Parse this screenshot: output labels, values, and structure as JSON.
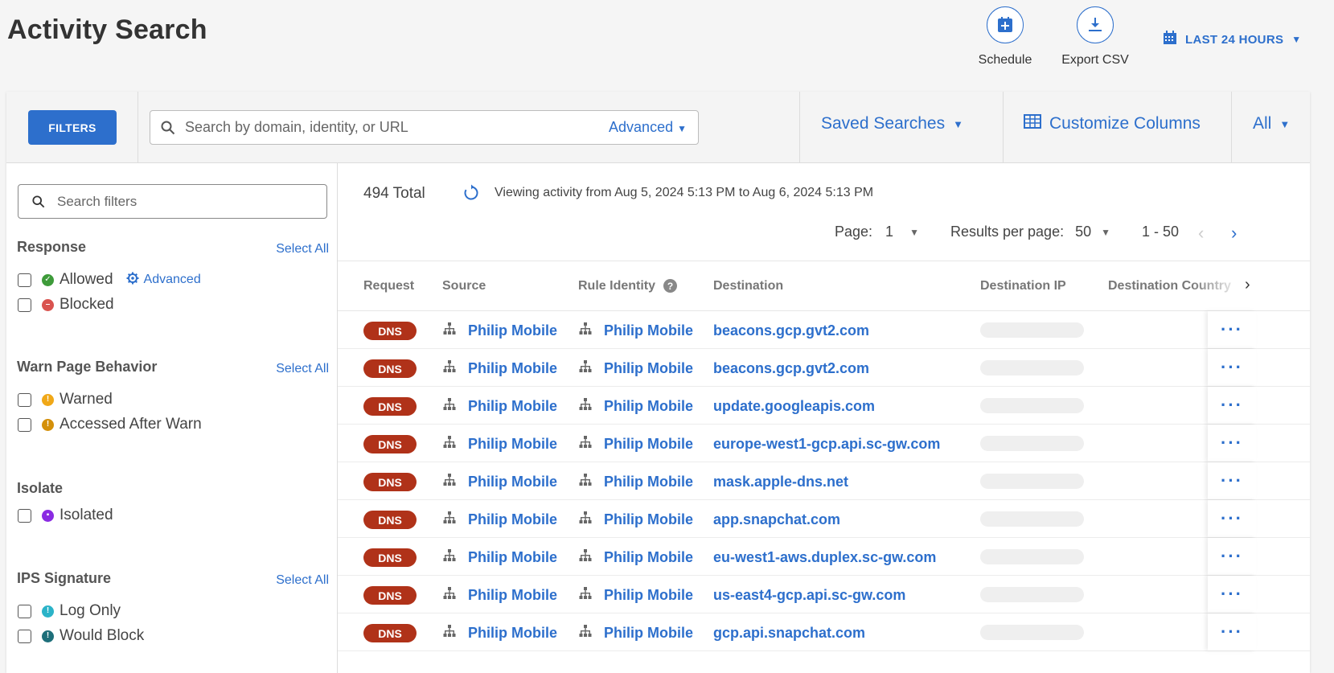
{
  "page": {
    "title": "Activity Search"
  },
  "header_actions": {
    "schedule_label": "Schedule",
    "export_label": "Export CSV",
    "time_range": "LAST 24 HOURS"
  },
  "toolbar": {
    "filters_label": "FILTERS",
    "search_placeholder": "Search by domain, identity, or URL",
    "advanced_label": "Advanced",
    "saved_searches_label": "Saved Searches",
    "customize_columns_label": "Customize Columns",
    "all_label": "All"
  },
  "sidebar": {
    "filter_search_placeholder": "Search filters",
    "select_all": "Select All",
    "sections": [
      {
        "title": "Response",
        "items": [
          {
            "label": "Allowed",
            "color": "#3e9b3a"
          },
          {
            "label": "Blocked",
            "color": "#d9534f"
          }
        ],
        "advanced_label": "Advanced"
      },
      {
        "title": "Warn Page Behavior",
        "items": [
          {
            "label": "Warned",
            "color": "#f0a818"
          },
          {
            "label": "Accessed After Warn",
            "color": "#d4900a"
          }
        ]
      },
      {
        "title": "Isolate",
        "items": [
          {
            "label": "Isolated",
            "color": "#8a2be2"
          }
        ]
      },
      {
        "title": "IPS Signature",
        "items": [
          {
            "label": "Log Only",
            "color": "#2bb3c8"
          },
          {
            "label": "Would Block",
            "color": "#1e6f7a"
          }
        ]
      }
    ]
  },
  "summary": {
    "total": "494 Total",
    "viewing": "Viewing activity from Aug 5, 2024 5:13 PM to Aug 6, 2024 5:13 PM",
    "page_label": "Page:",
    "page_value": "1",
    "rpp_label": "Results per page:",
    "rpp_value": "50",
    "range": "1 - 50"
  },
  "table": {
    "columns": [
      "Request",
      "Source",
      "Rule Identity",
      "Destination",
      "Destination IP",
      "Destination Country"
    ],
    "rows": [
      {
        "request": "DNS",
        "source": "Philip Mobile",
        "rule_identity": "Philip Mobile",
        "destination": "beacons.gcp.gvt2.com"
      },
      {
        "request": "DNS",
        "source": "Philip Mobile",
        "rule_identity": "Philip Mobile",
        "destination": "beacons.gcp.gvt2.com"
      },
      {
        "request": "DNS",
        "source": "Philip Mobile",
        "rule_identity": "Philip Mobile",
        "destination": "update.googleapis.com"
      },
      {
        "request": "DNS",
        "source": "Philip Mobile",
        "rule_identity": "Philip Mobile",
        "destination": "europe-west1-gcp.api.sc-gw.com"
      },
      {
        "request": "DNS",
        "source": "Philip Mobile",
        "rule_identity": "Philip Mobile",
        "destination": "mask.apple-dns.net"
      },
      {
        "request": "DNS",
        "source": "Philip Mobile",
        "rule_identity": "Philip Mobile",
        "destination": "app.snapchat.com"
      },
      {
        "request": "DNS",
        "source": "Philip Mobile",
        "rule_identity": "Philip Mobile",
        "destination": "eu-west1-aws.duplex.sc-gw.com"
      },
      {
        "request": "DNS",
        "source": "Philip Mobile",
        "rule_identity": "Philip Mobile",
        "destination": "us-east4-gcp.api.sc-gw.com"
      },
      {
        "request": "DNS",
        "source": "Philip Mobile",
        "rule_identity": "Philip Mobile",
        "destination": "gcp.api.snapchat.com"
      }
    ]
  },
  "colors": {
    "accent": "#2d6fcc",
    "dns_badge": "#b03219"
  }
}
